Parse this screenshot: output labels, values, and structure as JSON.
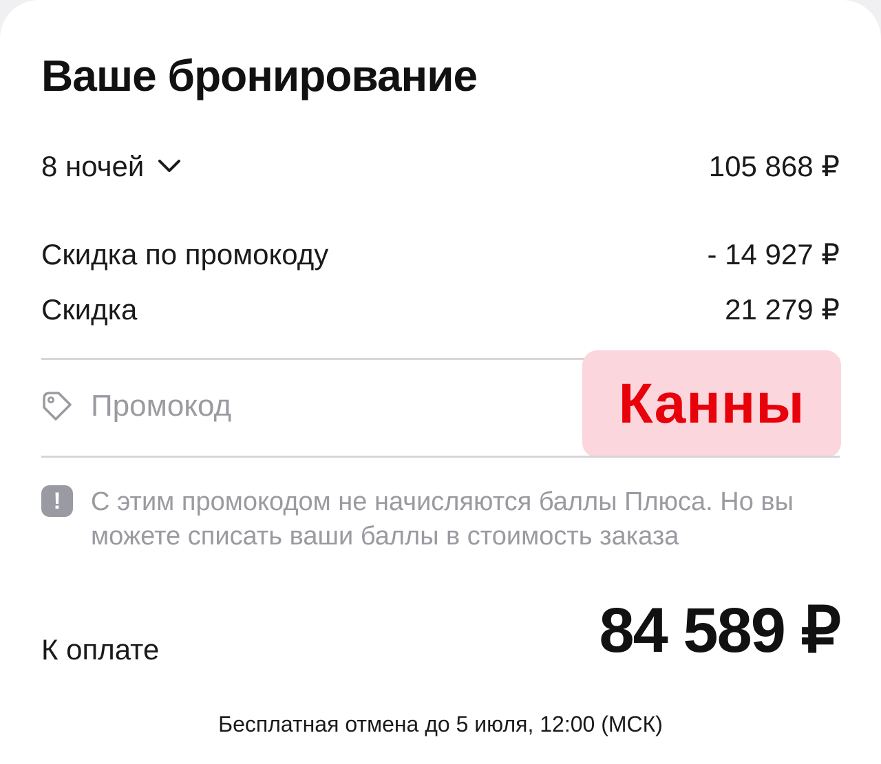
{
  "booking": {
    "title": "Ваше бронирование",
    "nights_label": "8 ночей",
    "nights_price": "105 868 ₽",
    "promo_discount_label": "Скидка по промокоду",
    "promo_discount_value": "- 14 927 ₽",
    "discount_label": "Скидка",
    "discount_value": "21 279 ₽"
  },
  "promo": {
    "placeholder": "Промокод",
    "code_badge": "Канны",
    "tag_icon": "ticket-tag-icon"
  },
  "notice": {
    "icon": "exclamation-icon",
    "text": "С этим промокодом не начисляются баллы Плюса. Но вы можете списать ваши баллы в стоимость заказа"
  },
  "total": {
    "label": "К оплате",
    "value": "84 589 ₽"
  },
  "footer": {
    "cancel_note": "Бесплатная отмена до 5 июля, 12:00 (МСК)"
  },
  "colors": {
    "badge_bg": "#fbd6dc",
    "badge_text": "#e8000a",
    "muted_text": "#9a9aa0",
    "divider": "#d6d6da"
  }
}
